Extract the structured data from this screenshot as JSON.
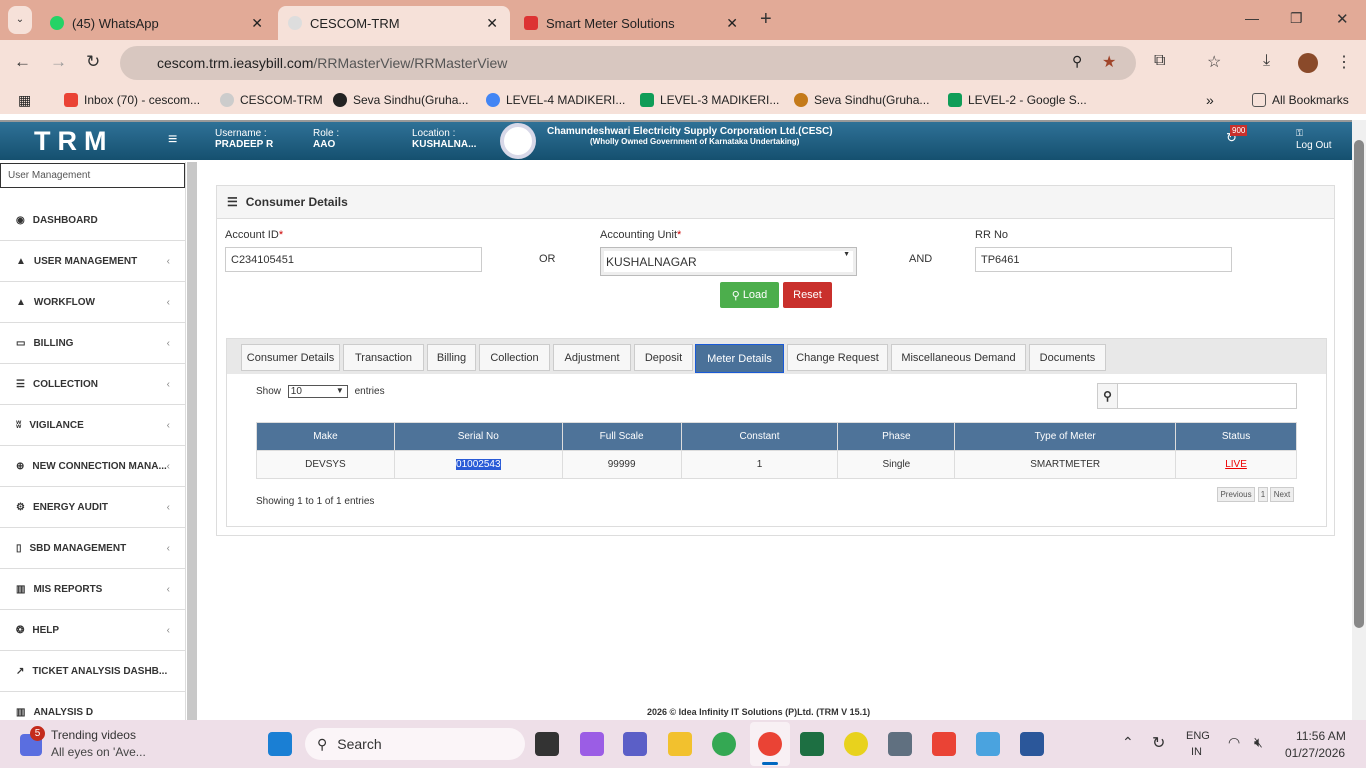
{
  "browser": {
    "tabs": [
      {
        "label": "(45) WhatsApp"
      },
      {
        "label": "CESCOM-TRM"
      },
      {
        "label": "Smart Meter Solutions"
      }
    ],
    "url_host": "cescom.trm.ieasybill.com",
    "url_path": "/RRMasterView/RRMasterView",
    "bookmarks": [
      "Inbox (70) - cescom...",
      "CESCOM-TRM",
      "Seva Sindhu(Gruha...",
      "LEVEL-4 MADIKERI...",
      "LEVEL-3 MADIKERI...",
      "Seva Sindhu(Gruha...",
      "LEVEL-2 - Google S..."
    ],
    "all_bookmarks": "All Bookmarks"
  },
  "header": {
    "logo": "TRM",
    "username_label": "Username :",
    "username": "PRADEEP R",
    "role_label": "Role :",
    "role": "AAO",
    "location_label": "Location :",
    "location": "KUSHALNA...",
    "org": "Chamundeshwari Electricity Supply Corporation Ltd.(CESC)",
    "org_sub": "(Wholly Owned Government of Karnataka Undertaking)",
    "badge": "900",
    "logout": "Log Out"
  },
  "sidebar": {
    "search_value": "User Management",
    "items": [
      "DASHBOARD",
      "USER MANAGEMENT",
      "WORKFLOW",
      "BILLING",
      "COLLECTION",
      "VIGILANCE",
      "NEW CONNECTION MANA...",
      "ENERGY AUDIT",
      "SBD MANAGEMENT",
      "MIS REPORTS",
      "HELP",
      "TICKET ANALYSIS DASHB...",
      "ANALYSIS D"
    ]
  },
  "panel": {
    "title": "Consumer Details",
    "account_label": "Account ID",
    "account_value": "C234105451",
    "or": "OR",
    "unit_label": "Accounting Unit",
    "unit_value": "KUSHALNAGAR",
    "and": "AND",
    "rr_label": "RR No",
    "rr_value": "TP6461",
    "load": "Load",
    "reset": "Reset",
    "tabs": [
      "Consumer Details",
      "Transaction",
      "Billing",
      "Collection",
      "Adjustment",
      "Deposit",
      "Meter Details",
      "Change Request",
      "Miscellaneous Demand",
      "Documents"
    ],
    "show": "Show",
    "entries_value": "10",
    "entries": "entries",
    "columns": [
      "Make",
      "Serial No",
      "Full Scale",
      "Constant",
      "Phase",
      "Type of Meter",
      "Status"
    ],
    "rows": [
      [
        "DEVSYS",
        "01002543",
        "99999",
        "1",
        "Single",
        "SMARTMETER",
        "LIVE"
      ]
    ],
    "info": "Showing 1 to 1 of 1 entries",
    "prev": "Previous",
    "page": "1",
    "next": "Next"
  },
  "footer": "2026 © Idea Infinity IT Solutions (P)Ltd. (TRM V 15.1)",
  "taskbar": {
    "news_badge": "5",
    "news_title": "Trending videos",
    "news_sub": "All eyes on 'Ave...",
    "search": "Search",
    "lang1": "ENG",
    "lang2": "IN",
    "time": "11:56 AM",
    "date": "01/27/2026"
  }
}
